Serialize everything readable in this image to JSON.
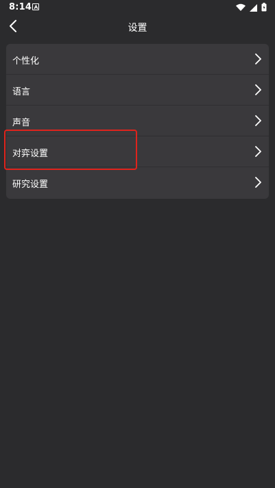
{
  "status_bar": {
    "time": "8:14",
    "notification_icon": "a-box-icon",
    "icons": [
      "wifi-icon",
      "signal-icon",
      "battery-icon"
    ]
  },
  "header": {
    "back_icon": "chevron-left-icon",
    "title": "设置"
  },
  "settings": {
    "items": [
      {
        "label": "个性化"
      },
      {
        "label": "语言"
      },
      {
        "label": "声音"
      },
      {
        "label": "对弈设置"
      },
      {
        "label": "研究设置"
      }
    ]
  },
  "colors": {
    "background": "#2b2b2d",
    "card": "#3a393c",
    "highlight": "#e0231c"
  }
}
